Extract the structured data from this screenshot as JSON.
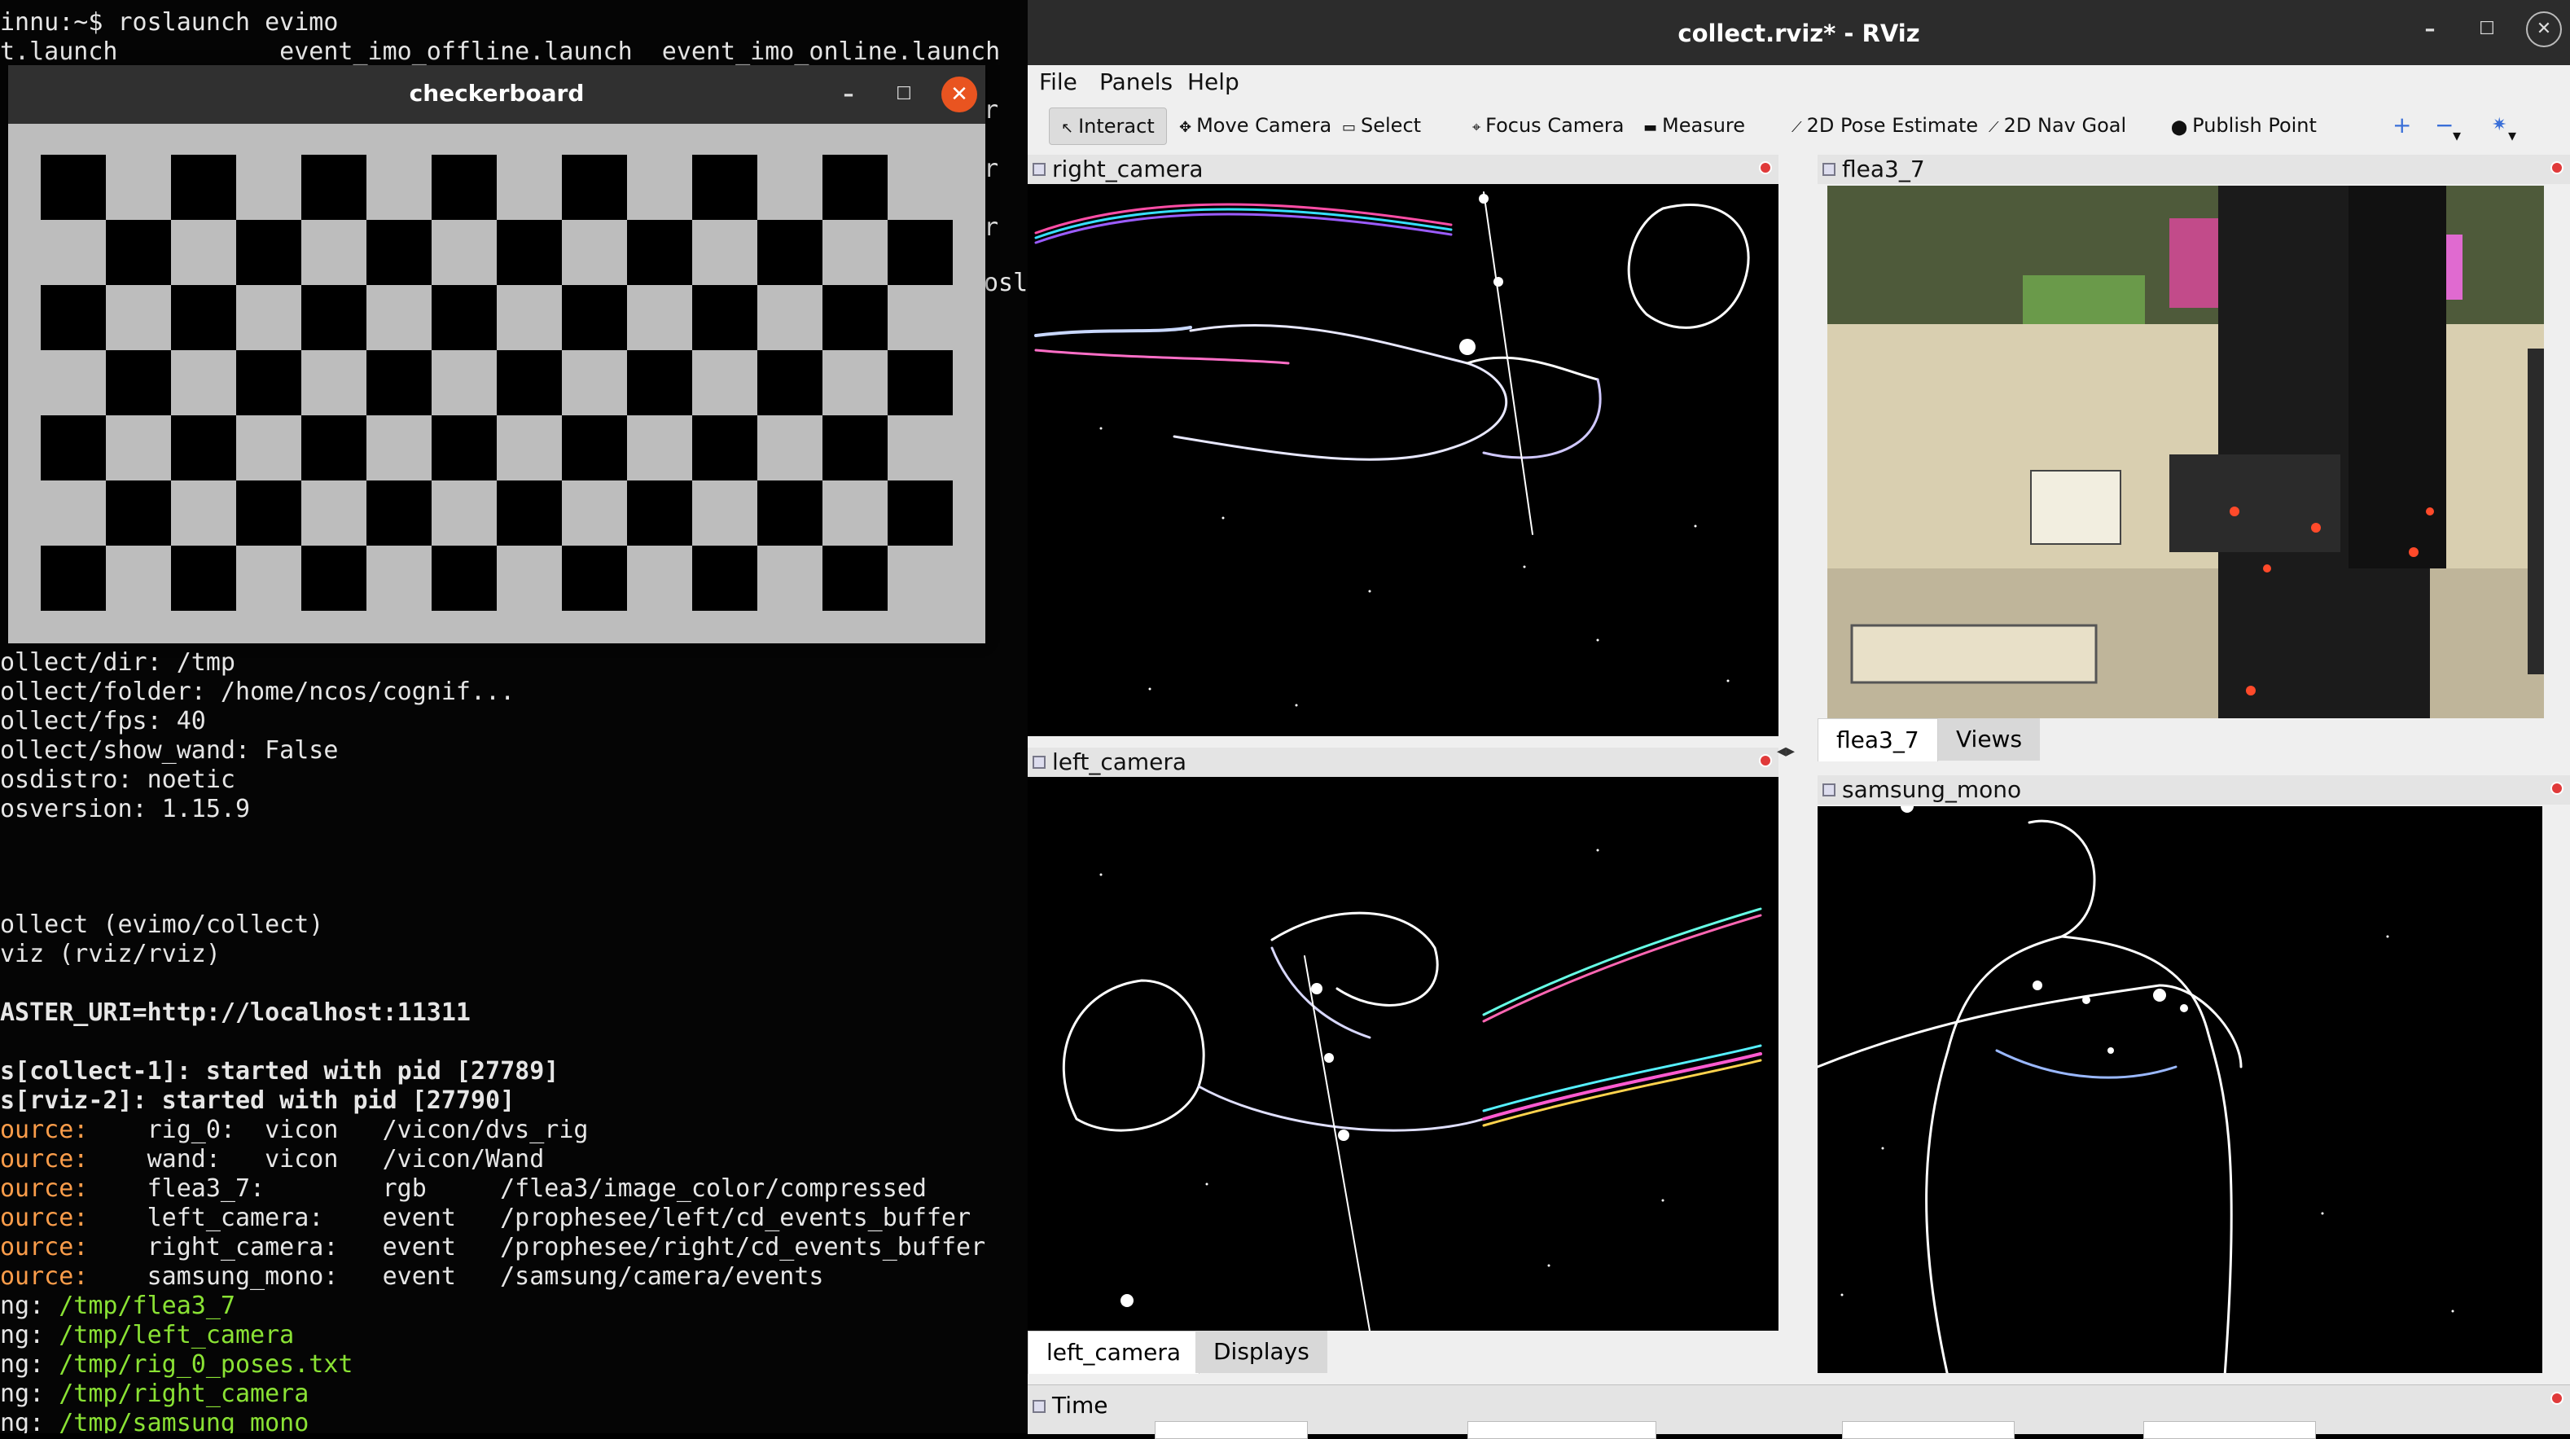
{
  "terminal": {
    "lines": [
      {
        "text": "innu:~$ roslaunch evimo",
        "cls": ""
      },
      {
        "text": "t.launch           event_imo_offline.launch  event_imo_online.launch",
        "cls": ""
      },
      {
        "text": "ollect/dir: /tmp",
        "cls": ""
      },
      {
        "text": "ollect/folder: /home/ncos/cognif...",
        "cls": ""
      },
      {
        "text": "ollect/fps: 40",
        "cls": ""
      },
      {
        "text": "ollect/show_wand: False",
        "cls": ""
      },
      {
        "text": "osdistro: noetic",
        "cls": ""
      },
      {
        "text": "osversion: 1.15.9",
        "cls": ""
      },
      {
        "text": "ollect (evimo/collect)",
        "cls": ""
      },
      {
        "text": "viz (rviz/rviz)",
        "cls": ""
      },
      {
        "text": "ASTER_URI=http://localhost:11311",
        "cls": "bold"
      },
      {
        "text": "s[collect-1]: started with pid [27789]",
        "cls": "bold"
      },
      {
        "text": "s[rviz-2]: started with pid [27790]",
        "cls": "bold"
      },
      {
        "prefix": "ource:",
        "text": "    rig_0:  vicon   /vicon/dvs_rig"
      },
      {
        "prefix": "ource:",
        "text": "    wand:   vicon   /vicon/Wand"
      },
      {
        "prefix": "ource:",
        "text": "    flea3_7:        rgb     /flea3/image_color/compressed"
      },
      {
        "prefix": "ource:",
        "text": "    left_camera:    event   /prophesee/left/cd_events_buffer"
      },
      {
        "prefix": "ource:",
        "text": "    right_camera:   event   /prophesee/right/cd_events_buffer"
      },
      {
        "prefix": "ource:",
        "text": "    samsung_mono:   event   /samsung/camera/events"
      },
      {
        "prefix": "ng: ",
        "text": "/tmp/flea3_7"
      },
      {
        "prefix": "ng: ",
        "text": "/tmp/left_camera"
      },
      {
        "prefix": "ng: ",
        "text": "/tmp/rig_0_poses.txt"
      },
      {
        "prefix": "ng: ",
        "text": "/tmp/right_camera"
      },
      {
        "prefix": "ng: ",
        "text": "/tmp/samsung_mono"
      }
    ],
    "side_fragments": [
      "r",
      "r",
      "r",
      "osl"
    ]
  },
  "checkerboard": {
    "title": "checkerboard",
    "minimize": "–",
    "maximize": "☐",
    "close": "✕",
    "rows": 7,
    "cols": 14,
    "dark": "#000000",
    "light": "#bdbdbd"
  },
  "rviz": {
    "title": "collect.rviz* - RViz",
    "window_controls": {
      "minimize": "–",
      "maximize": "☐",
      "close": "✕"
    },
    "menu": [
      "File",
      "Panels",
      "Help"
    ],
    "toolbar": [
      {
        "label": "Interact",
        "icon": "interact-icon",
        "glyph": "↖"
      },
      {
        "label": "Move Camera",
        "icon": "move-camera-icon",
        "glyph": "✥"
      },
      {
        "label": "Select",
        "icon": "select-icon",
        "glyph": "▭"
      },
      {
        "label": "Focus Camera",
        "icon": "focus-camera-icon",
        "glyph": "⌖"
      },
      {
        "label": "Measure",
        "icon": "measure-icon",
        "glyph": "▬"
      },
      {
        "label": "2D Pose Estimate",
        "icon": "pose-estimate-icon",
        "glyph": "⟋"
      },
      {
        "label": "2D Nav Goal",
        "icon": "nav-goal-icon",
        "glyph": "⟋"
      },
      {
        "label": "Publish Point",
        "icon": "publish-point-icon",
        "glyph": "⬤"
      }
    ],
    "toolbar_extra": {
      "plus": "+",
      "minus": "−",
      "dropdown": "▾"
    },
    "panels": {
      "right_camera": "right_camera",
      "left_camera": "left_camera",
      "flea3": "flea3_7",
      "samsung": "samsung_mono",
      "time": "Time"
    },
    "tabs": {
      "left": [
        "left_camera",
        "Displays"
      ],
      "right": [
        "flea3_7",
        "Views"
      ]
    },
    "splitter": "◂▸",
    "colors": {
      "accent": "#e95420",
      "close_dot": "#e03a3a"
    }
  }
}
